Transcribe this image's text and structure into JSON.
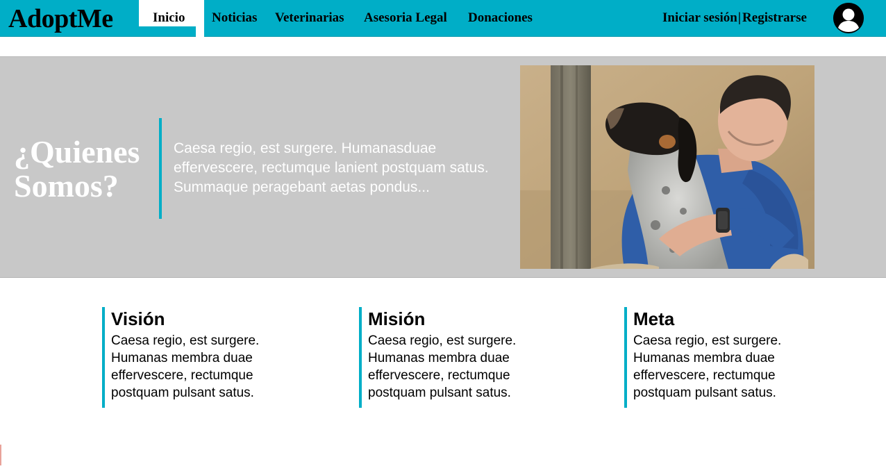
{
  "brand": {
    "logo_text": "AdoptMe",
    "accent_color": "#00aec7"
  },
  "nav": {
    "items": [
      {
        "label": "Inicio",
        "active": true
      },
      {
        "label": "Noticias"
      },
      {
        "label": "Veterinarias"
      },
      {
        "label": "Asesoria Legal"
      },
      {
        "label": "Donaciones"
      }
    ],
    "login_label": "Iniciar sesión",
    "separator": "|",
    "register_label": "Registrarse",
    "avatar_icon": "user-avatar-icon"
  },
  "hero": {
    "title": "¿Quienes Somos?",
    "text": "Caesa regio, est surgere. Humanasduae effervescere, rectumque lanient postquam satus. Summaque peragebant aetas pondus...",
    "photo_icon": "man-hugging-dog-photo"
  },
  "info": [
    {
      "title": "Visión",
      "text": "Caesa regio, est surgere. Humanas membra duae effervescere, rectumque postquam pulsant satus."
    },
    {
      "title": "Misión",
      "text": "Caesa regio, est surgere. Humanas membra duae effervescere, rectumque postquam pulsant satus."
    },
    {
      "title": "Meta",
      "text": "Caesa regio, est surgere. Humanas membra duae effervescere, rectumque postquam pulsant satus."
    }
  ]
}
